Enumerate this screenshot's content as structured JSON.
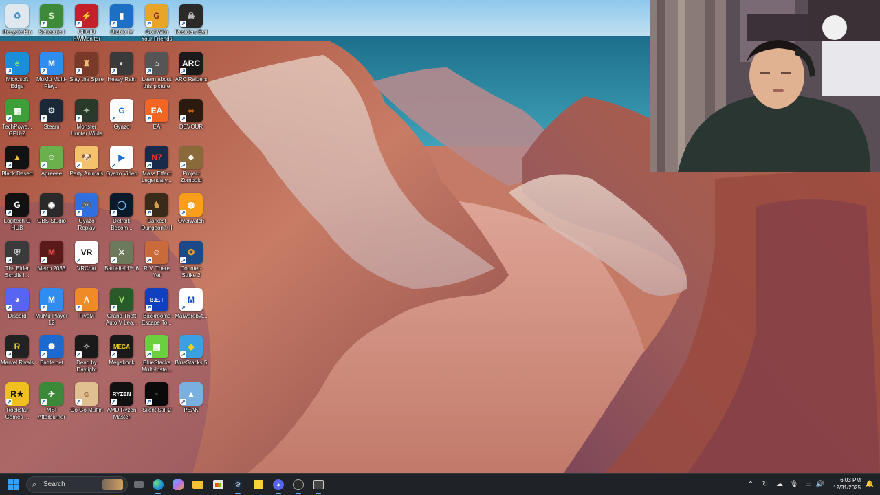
{
  "desktop_icons": [
    {
      "label": "Recycle Bin",
      "icon": "recycle-bin-icon",
      "bg": "#dfe7ef",
      "glyph": "♻",
      "fg": "#3a8fd0"
    },
    {
      "label": "Schedule I",
      "icon": "schedule-one-icon",
      "bg": "#3c8a3a",
      "glyph": "S",
      "fg": "#d7f0c8"
    },
    {
      "label": "CPUID HWMonitor",
      "icon": "hwmonitor-icon",
      "bg": "#c4202a",
      "glyph": "⚡",
      "fg": "#fff"
    },
    {
      "label": "Diablo IV",
      "icon": "diablo-icon",
      "bg": "#1d6fc4",
      "glyph": "▮",
      "fg": "#fff"
    },
    {
      "label": "Golf With Your Friends",
      "icon": "golf-icon",
      "bg": "#e8a527",
      "glyph": "G",
      "fg": "#7a2a00"
    },
    {
      "label": "Resident Evil",
      "icon": "resident-evil-icon",
      "bg": "#2b2a28",
      "glyph": "☠",
      "fg": "#c9c9c9"
    },
    {
      "label": "Microsoft Edge",
      "icon": "edge-icon",
      "bg": "#1a8ed8",
      "glyph": "e",
      "fg": "#7ee07b"
    },
    {
      "label": "MuMu Multi-Play...",
      "icon": "mumu-multi-icon",
      "bg": "#2f8cf0",
      "glyph": "M",
      "fg": "#fff"
    },
    {
      "label": "Slay the Spire",
      "icon": "slay-the-spire-icon",
      "bg": "#7a3a2a",
      "glyph": "♜",
      "fg": "#f0c070"
    },
    {
      "label": "Heavy Rain",
      "icon": "heavy-rain-icon",
      "bg": "#3a3a3a",
      "glyph": "◐",
      "fg": "#ddd"
    },
    {
      "label": "Learn about this picture",
      "icon": "learn-picture-icon",
      "bg": "#555555",
      "glyph": "⌂",
      "fg": "#fff"
    },
    {
      "label": "ARC Raiders",
      "icon": "arc-raiders-icon",
      "bg": "#1a1a1a",
      "glyph": "ARC",
      "fg": "#fff"
    },
    {
      "label": "TechPowe... GPU-Z",
      "icon": "gpu-z-icon",
      "bg": "#3d9f3a",
      "glyph": "▦",
      "fg": "#fff"
    },
    {
      "label": "Steam",
      "icon": "steam-icon",
      "bg": "#1b2838",
      "glyph": "⚙",
      "fg": "#c7d5e0"
    },
    {
      "label": "Monster Hunter Wilds",
      "icon": "monster-hunter-icon",
      "bg": "#2a3a2a",
      "glyph": "✦",
      "fg": "#a0c0a0"
    },
    {
      "label": "Gyazo",
      "icon": "gyazo-icon",
      "bg": "#ffffff",
      "glyph": "G",
      "fg": "#1f6fd6"
    },
    {
      "label": "EA",
      "icon": "ea-icon",
      "bg": "#f26522",
      "glyph": "EA",
      "fg": "#fff"
    },
    {
      "label": "DEVOUR",
      "icon": "devour-icon",
      "bg": "#2a1a10",
      "glyph": "∞",
      "fg": "#e07020"
    },
    {
      "label": "Black Desert",
      "icon": "black-desert-icon",
      "bg": "#121212",
      "glyph": "▲",
      "fg": "#f0c040"
    },
    {
      "label": "Agreeee",
      "icon": "agreeee-icon",
      "bg": "#6ab04c",
      "glyph": "☺",
      "fg": "#fff"
    },
    {
      "label": "Party Animals",
      "icon": "party-animals-icon",
      "bg": "#f4c26b",
      "glyph": "🐶",
      "fg": "#8a4a10"
    },
    {
      "label": "Gyazo Video",
      "icon": "gyazo-video-icon",
      "bg": "#ffffff",
      "glyph": "▶",
      "fg": "#1f6fd6"
    },
    {
      "label": "Mass Effect Legendary...",
      "icon": "mass-effect-icon",
      "bg": "#1a2a4a",
      "glyph": "N7",
      "fg": "#ff3030"
    },
    {
      "label": "Project Zomboid",
      "icon": "project-zomboid-icon",
      "bg": "#8a6a3a",
      "glyph": "☻",
      "fg": "#fff"
    },
    {
      "label": "Logitech G HUB",
      "icon": "logitech-ghub-icon",
      "bg": "#111111",
      "glyph": "G",
      "fg": "#fff"
    },
    {
      "label": "OBS Studio",
      "icon": "obs-icon",
      "bg": "#2a2a2a",
      "glyph": "◉",
      "fg": "#fff"
    },
    {
      "label": "Gyazo Replay",
      "icon": "gyazo-replay-icon",
      "bg": "#2f6fe0",
      "glyph": "🎮",
      "fg": "#fff"
    },
    {
      "label": "Detroit: Becom...",
      "icon": "detroit-icon",
      "bg": "#0a1a2a",
      "glyph": "◯",
      "fg": "#6fc0ff"
    },
    {
      "label": "Darkest Dungeon® II",
      "icon": "darkest-dungeon-icon",
      "bg": "#3a2a1a",
      "glyph": "♞",
      "fg": "#d0a050"
    },
    {
      "label": "Overwatch",
      "icon": "overwatch-icon",
      "bg": "#f99e1a",
      "glyph": "◍",
      "fg": "#fff"
    },
    {
      "label": "The Elder Scrolls I...",
      "icon": "elder-scrolls-icon",
      "bg": "#3a3a3a",
      "glyph": "⛨",
      "fg": "#ccc"
    },
    {
      "label": "Metro 2033",
      "icon": "metro-icon",
      "bg": "#5a1a1a",
      "glyph": "M",
      "fg": "#ff5050"
    },
    {
      "label": "VRChat",
      "icon": "vrchat-icon",
      "bg": "#ffffff",
      "glyph": "VR",
      "fg": "#111"
    },
    {
      "label": "Battlefield™ 6",
      "icon": "battlefield-icon",
      "bg": "#6a7a5a",
      "glyph": "⚔",
      "fg": "#fff"
    },
    {
      "label": "R.V. There Yet",
      "icon": "rv-there-yet-icon",
      "bg": "#c86a3a",
      "glyph": "☺",
      "fg": "#fff"
    },
    {
      "label": "Counter-Strike 2",
      "icon": "counter-strike-icon",
      "bg": "#1a4a8a",
      "glyph": "✪",
      "fg": "#f0a030"
    },
    {
      "label": "Discord",
      "icon": "discord-icon",
      "bg": "#5865f2",
      "glyph": "◕",
      "fg": "#fff"
    },
    {
      "label": "MuMu Player 12",
      "icon": "mumu-player-icon",
      "bg": "#2f8cf0",
      "glyph": "M",
      "fg": "#fff"
    },
    {
      "label": "FiveM",
      "icon": "fivem-icon",
      "bg": "#f08a24",
      "glyph": "Λ",
      "fg": "#fff"
    },
    {
      "label": "Grand Theft Auto V Lea...",
      "icon": "gta-icon",
      "bg": "#2a5a2a",
      "glyph": "V",
      "fg": "#9be36a"
    },
    {
      "label": "Backrooms Escape To...",
      "icon": "backrooms-icon",
      "bg": "#1040c0",
      "glyph": "B.E.T",
      "fg": "#fff"
    },
    {
      "label": "Malwarebyt...",
      "icon": "malwarebytes-icon",
      "bg": "#ffffff",
      "glyph": "M",
      "fg": "#1a4ad0"
    },
    {
      "label": "Marvel Rivals",
      "icon": "marvel-rivals-icon",
      "bg": "#222222",
      "glyph": "R",
      "fg": "#f0d020"
    },
    {
      "label": "Battle.net",
      "icon": "battlenet-icon",
      "bg": "#1a6ad0",
      "glyph": "✺",
      "fg": "#fff"
    },
    {
      "label": "Dead by Daylight",
      "icon": "dead-by-daylight-icon",
      "bg": "#1a1a1a",
      "glyph": "✧",
      "fg": "#aaa"
    },
    {
      "label": "Megabonk",
      "icon": "megabonk-icon",
      "bg": "#1a1a1a",
      "glyph": "MEGA",
      "fg": "#f0d020"
    },
    {
      "label": "BlueStacks Multi-Insta...",
      "icon": "bluestacks-multi-icon",
      "bg": "#6ad040",
      "glyph": "▦",
      "fg": "#fff"
    },
    {
      "label": "BlueStacks 5",
      "icon": "bluestacks-icon",
      "bg": "#3aa0e0",
      "glyph": "◆",
      "fg": "#f0d020"
    },
    {
      "label": "Rockstar Games ...",
      "icon": "rockstar-icon",
      "bg": "#f0c020",
      "glyph": "R★",
      "fg": "#111"
    },
    {
      "label": "MSI Afterburner",
      "icon": "msi-afterburner-icon",
      "bg": "#3a8a3a",
      "glyph": "✈",
      "fg": "#fff"
    },
    {
      "label": "Go Go Muffin",
      "icon": "go-go-muffin-icon",
      "bg": "#e0c090",
      "glyph": "☺",
      "fg": "#804020"
    },
    {
      "label": "AMD Ryzen Master",
      "icon": "amd-ryzen-icon",
      "bg": "#111111",
      "glyph": "RYZEN",
      "fg": "#fff"
    },
    {
      "label": "Silent Still 2",
      "icon": "silent-still-icon",
      "bg": "#0a0a0a",
      "glyph": "▪",
      "fg": "#444"
    },
    {
      "label": "PEAK",
      "icon": "peak-icon",
      "bg": "#7ab0e0",
      "glyph": "▲",
      "fg": "#fff"
    }
  ],
  "taskbar": {
    "search_placeholder": "Search",
    "apps": [
      {
        "name": "file-explorer-tray",
        "icon": "file-explorer-icon"
      },
      {
        "name": "edge-taskbar",
        "icon": "edge-icon"
      },
      {
        "name": "copilot-taskbar",
        "icon": "copilot-icon"
      },
      {
        "name": "folder-taskbar",
        "icon": "folder-icon"
      },
      {
        "name": "store-taskbar",
        "icon": "store-icon"
      },
      {
        "name": "steam-taskbar",
        "icon": "steam-icon"
      },
      {
        "name": "sticky-taskbar",
        "icon": "sticky-notes-icon"
      },
      {
        "name": "discord-taskbar",
        "icon": "discord-icon"
      },
      {
        "name": "obs-taskbar",
        "icon": "obs-icon"
      },
      {
        "name": "capture-taskbar",
        "icon": "capture-icon"
      }
    ]
  },
  "clock": {
    "time": "6:03 PM",
    "date": "12/31/2025"
  },
  "colors": {
    "accent": "#0078d4",
    "taskbar": "#1f2227"
  }
}
